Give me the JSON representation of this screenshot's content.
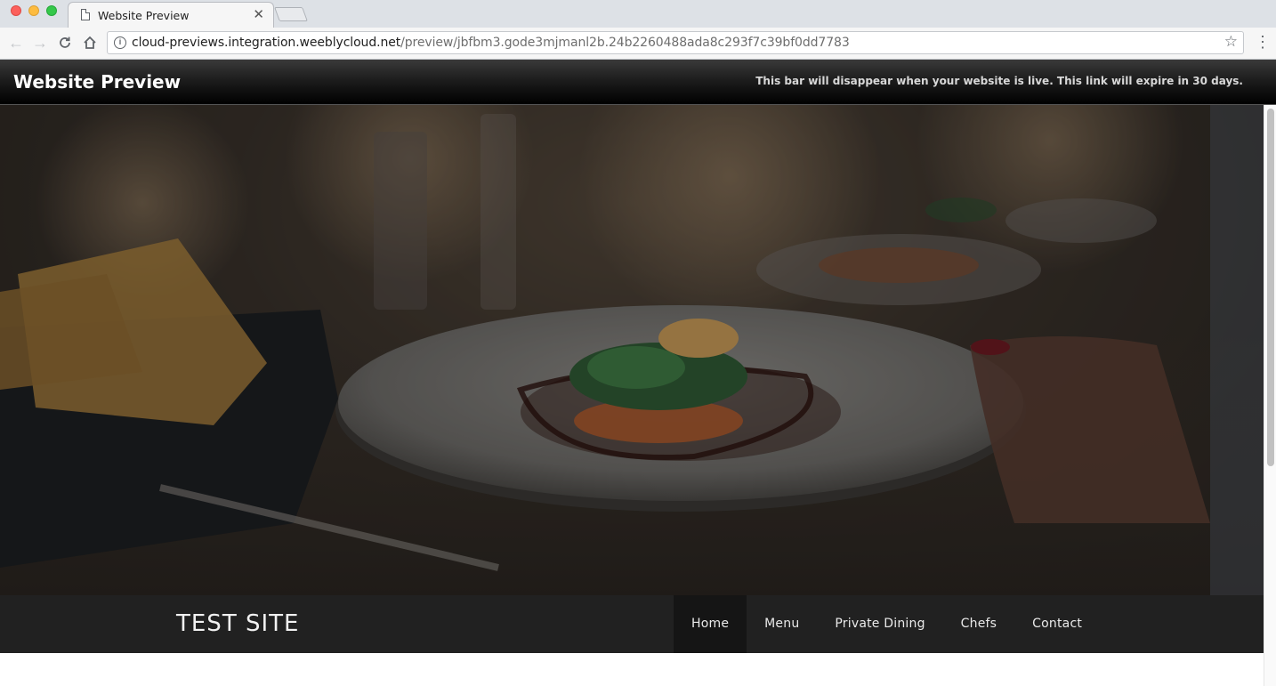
{
  "browser": {
    "tab": {
      "title": "Website Preview"
    },
    "toolbar": {
      "url_host": "cloud-previews.integration.weeblycloud.net",
      "url_path": "/preview/jbfbm3.gode3mjmanl2b.24b2260488ada8c293f7c39bf0dd7783"
    },
    "icons": {
      "back": "back-arrow-icon",
      "forward": "forward-arrow-icon",
      "reload": "reload-icon",
      "home": "home-icon",
      "info": "info-icon",
      "bookmark": "star-icon",
      "menu": "kebab-menu-icon",
      "close": "close-icon"
    }
  },
  "preview_bar": {
    "title": "Website Preview",
    "note": "This bar will disappear when your website is live. This link will expire in 30 days."
  },
  "site": {
    "title": "TEST SITE",
    "nav": [
      {
        "label": "Home",
        "active": true
      },
      {
        "label": "Menu",
        "active": false
      },
      {
        "label": "Private Dining",
        "active": false
      },
      {
        "label": "Chefs",
        "active": false
      },
      {
        "label": "Contact",
        "active": false
      }
    ]
  },
  "colors": {
    "preview_bar": "#000000",
    "site_header": "#212121",
    "nav_active": "#151515"
  }
}
